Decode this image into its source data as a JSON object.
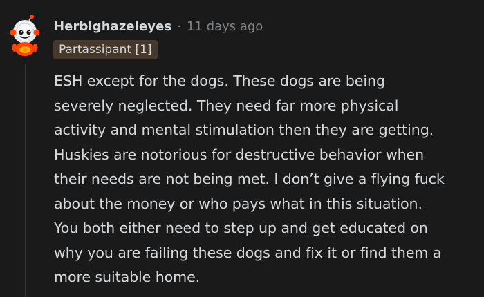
{
  "comment": {
    "author": "Herbighazeleyes",
    "separator": "·",
    "timestamp": "11 days ago",
    "flair": "Partassipant [1]",
    "body_lines": [
      "ESH except for the dogs. These dogs are being",
      "severely neglected. They need far more physical",
      "activity and mental stimulation then they are getting.",
      "Huskies are notorious for destructive behavior when",
      "their needs are not being met. I don’t give a flying fuck",
      "about the money or who pays what in this situation.",
      "You both either need to step up and get educated on",
      "why you are failing these dogs and fix it or find them a",
      "more suitable home."
    ]
  },
  "colors": {
    "background": "#1a1a1b",
    "text_primary": "#d7dadc",
    "text_muted": "#818384",
    "flair_background": "#46382b",
    "thread_line": "#343536",
    "avatar_suit": "#ff4500"
  },
  "icons": {
    "avatar": "reddit-snoo-astronaut-avatar"
  }
}
